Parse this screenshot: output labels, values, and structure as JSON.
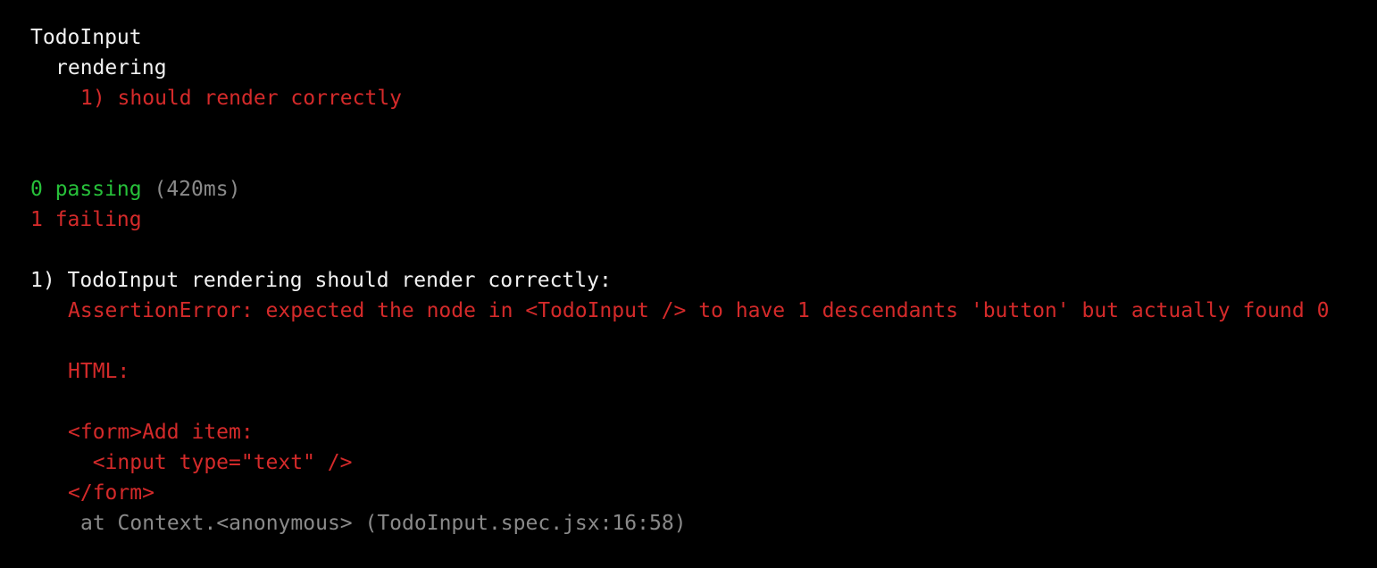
{
  "suite": {
    "name": "TodoInput",
    "subsuite": "rendering",
    "failed_test": "1) should render correctly"
  },
  "summary": {
    "passing": "0 passing",
    "duration": "(420ms)",
    "failing": "1 failing"
  },
  "failure": {
    "title": "1) TodoInput rendering should render correctly:",
    "error": "AssertionError: expected the node in <TodoInput /> to have 1 descendants 'button' but actually found 0",
    "html_label": "HTML:",
    "html_lines": [
      "<form>Add item:",
      "  <input type=\"text\" />",
      "</form>"
    ],
    "stack": "at Context.<anonymous> (TodoInput.spec.jsx:16:58)"
  },
  "colors": {
    "background": "#000000",
    "text": "#f2f2f2",
    "fail": "#d42a2a",
    "pass": "#27c13a",
    "dim": "#8a8a8a"
  }
}
